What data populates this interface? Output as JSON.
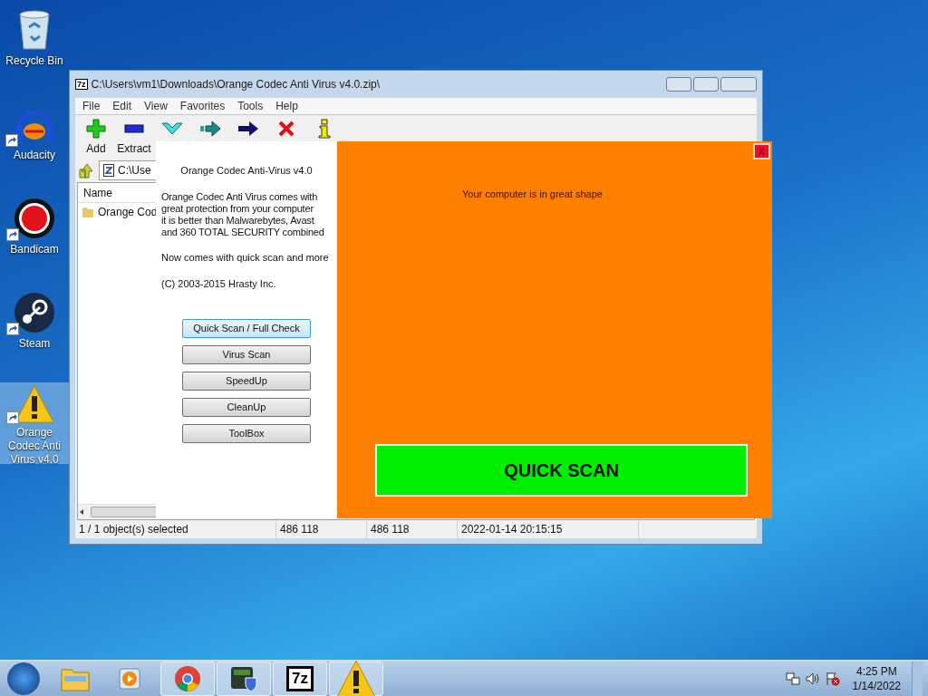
{
  "desktop_icons": [
    {
      "label": "Recycle Bin",
      "kind": "bin",
      "shortcut": false,
      "selected": false
    },
    {
      "label": "Audacity",
      "kind": "audio",
      "shortcut": true,
      "selected": false
    },
    {
      "label": "Bandicam",
      "kind": "record",
      "shortcut": true,
      "selected": false
    },
    {
      "label": "Steam",
      "kind": "steam",
      "shortcut": true,
      "selected": false
    },
    {
      "label": "Orange Codec Anti Virus v4.0",
      "kind": "warning",
      "shortcut": true,
      "selected": true
    }
  ],
  "archive_window": {
    "title": "C:\\Users\\vm1\\Downloads\\Orange Codec Anti Virus v4.0.zip\\",
    "menu": [
      "File",
      "Edit",
      "View",
      "Favorites",
      "Tools",
      "Help"
    ],
    "toolbar": [
      {
        "kind": "add",
        "label": "Add"
      },
      {
        "kind": "extract",
        "label": "Extract"
      },
      {
        "kind": "test"
      },
      {
        "kind": "copy"
      },
      {
        "kind": "move"
      },
      {
        "kind": "delete"
      },
      {
        "kind": "info"
      }
    ],
    "address": "C:\\Use",
    "columns": [
      "Name"
    ],
    "rows": [
      {
        "name": "Orange Cod"
      }
    ],
    "status_bar": [
      "1 / 1 object(s) selected",
      "486 118",
      "486 118",
      "2022-01-14 20:15:15"
    ]
  },
  "popup": {
    "heading": "Orange Codec Anti-Virus v4.0",
    "description": "Orange Codec Anti Virus comes with\ngreat protection from your computer\nit is better than Malwarebytes, Avast\nand 360 TOTAL SECURITY combined",
    "note": "Now comes with quick scan and more",
    "copyright": "(C) 2003-2015 Hrasty Inc.",
    "buttons": [
      {
        "label": "Quick Scan / Full Check",
        "selected": true
      },
      {
        "label": "Virus Scan",
        "selected": false
      },
      {
        "label": "SpeedUp",
        "selected": false
      },
      {
        "label": "CleanUp",
        "selected": false
      },
      {
        "label": "ToolBox",
        "selected": false
      }
    ],
    "close": "X",
    "status": "Your computer is in great shape",
    "action": "QUICK SCAN"
  },
  "taskbar": {
    "apps": [
      {
        "kind": "folder",
        "open": false
      },
      {
        "kind": "media",
        "open": false
      },
      {
        "kind": "chrome",
        "open": true
      },
      {
        "kind": "shield",
        "open": true
      },
      {
        "kind": "7z",
        "label": "7z",
        "open": true
      },
      {
        "kind": "warning",
        "open": true
      }
    ],
    "time": "4:25 PM",
    "date": "1/14/2022"
  }
}
